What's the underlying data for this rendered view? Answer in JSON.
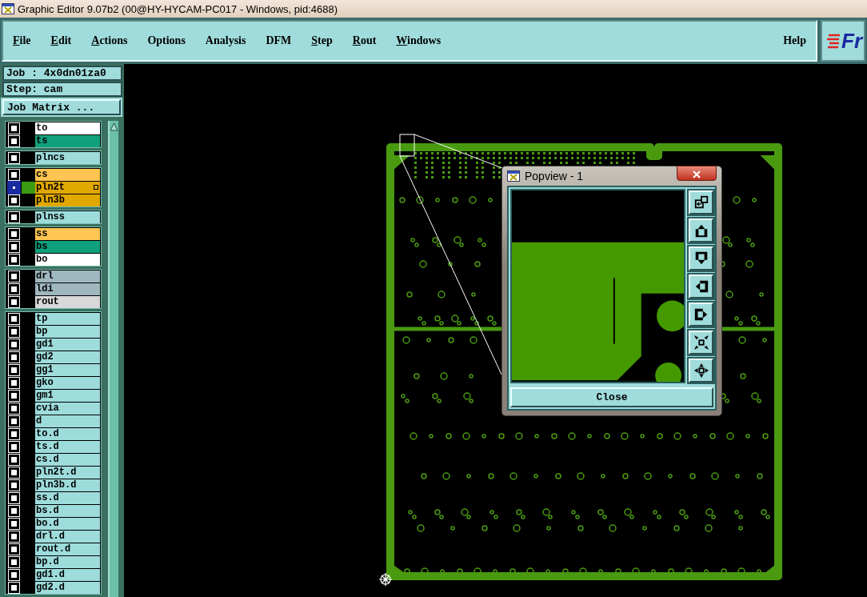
{
  "window": {
    "title": "Graphic Editor 9.07b2 (00@HY-HYCAM-PC017 - Windows, pid:4688)"
  },
  "menu": [
    {
      "label": "File",
      "mnemonic": true
    },
    {
      "label": "Edit",
      "mnemonic": true
    },
    {
      "label": "Actions",
      "mnemonic": true
    },
    {
      "label": "Options",
      "mnemonic": false
    },
    {
      "label": "Analysis",
      "mnemonic": false
    },
    {
      "label": "DFM",
      "mnemonic": false
    },
    {
      "label": "Step",
      "mnemonic": true
    },
    {
      "label": "Rout",
      "mnemonic": true
    },
    {
      "label": "Windows",
      "mnemonic": true
    }
  ],
  "help": "Help",
  "logo": "Fr",
  "job": "Job : 4x0dn01za0",
  "step": "Step: cam",
  "job_matrix_button": "Job Matrix ...",
  "layer_groups": [
    {
      "layers": [
        {
          "name": "to",
          "color": "#ffffff",
          "displayed": false
        },
        {
          "name": "ts",
          "color": "#11a07c",
          "displayed": false
        }
      ]
    },
    {
      "layers": [
        {
          "name": "plncs",
          "color": "#9edcdc",
          "displayed": false
        }
      ]
    },
    {
      "layers": [
        {
          "name": "cs",
          "color": "#ffc552",
          "displayed": false
        },
        {
          "name": "pln2t",
          "color": "#e0a800",
          "displayed": true
        },
        {
          "name": "pln3b",
          "color": "#e0a800",
          "displayed": false
        }
      ]
    },
    {
      "layers": [
        {
          "name": "plnss",
          "color": "#9edcdc",
          "displayed": false
        }
      ]
    },
    {
      "layers": [
        {
          "name": "ss",
          "color": "#ffc552",
          "displayed": false
        },
        {
          "name": "bs",
          "color": "#11a07c",
          "displayed": false
        },
        {
          "name": "bo",
          "color": "#ffffff",
          "displayed": false
        }
      ]
    },
    {
      "layers": [
        {
          "name": "drl",
          "color": "#9fb8c0",
          "displayed": false
        },
        {
          "name": "ldi",
          "color": "#9fb8c0",
          "displayed": false
        },
        {
          "name": "rout",
          "color": "#d8d8d8",
          "displayed": false
        }
      ]
    },
    {
      "layers": [
        {
          "name": "tp",
          "color": "#9edcdc",
          "displayed": false
        },
        {
          "name": "bp",
          "color": "#9edcdc",
          "displayed": false
        },
        {
          "name": "gd1",
          "color": "#9edcdc",
          "displayed": false
        },
        {
          "name": "gd2",
          "color": "#9edcdc",
          "displayed": false
        },
        {
          "name": "gg1",
          "color": "#9edcdc",
          "displayed": false
        },
        {
          "name": "gko",
          "color": "#9edcdc",
          "displayed": false
        },
        {
          "name": "gm1",
          "color": "#9edcdc",
          "displayed": false
        },
        {
          "name": "cvia",
          "color": "#9edcdc",
          "displayed": false
        },
        {
          "name": "d",
          "color": "#9edcdc",
          "displayed": false
        },
        {
          "name": "to.d",
          "color": "#9edcdc",
          "displayed": false
        },
        {
          "name": "ts.d",
          "color": "#9edcdc",
          "displayed": false
        },
        {
          "name": "cs.d",
          "color": "#9edcdc",
          "displayed": false
        },
        {
          "name": "pln2t.d",
          "color": "#9edcdc",
          "displayed": false
        },
        {
          "name": "pln3b.d",
          "color": "#9edcdc",
          "displayed": false
        },
        {
          "name": "ss.d",
          "color": "#9edcdc",
          "displayed": false
        },
        {
          "name": "bs.d",
          "color": "#9edcdc",
          "displayed": false
        },
        {
          "name": "bo.d",
          "color": "#9edcdc",
          "displayed": false
        },
        {
          "name": "drl.d",
          "color": "#9edcdc",
          "displayed": false
        },
        {
          "name": "rout.d",
          "color": "#9edcdc",
          "displayed": false
        },
        {
          "name": "bp.d",
          "color": "#9edcdc",
          "displayed": false
        },
        {
          "name": "gd1.d",
          "color": "#9edcdc",
          "displayed": false
        },
        {
          "name": "gd2.d",
          "color": "#9edcdc",
          "displayed": false
        }
      ]
    }
  ],
  "popview": {
    "title": "Popview - 1",
    "close_button": "Close"
  }
}
